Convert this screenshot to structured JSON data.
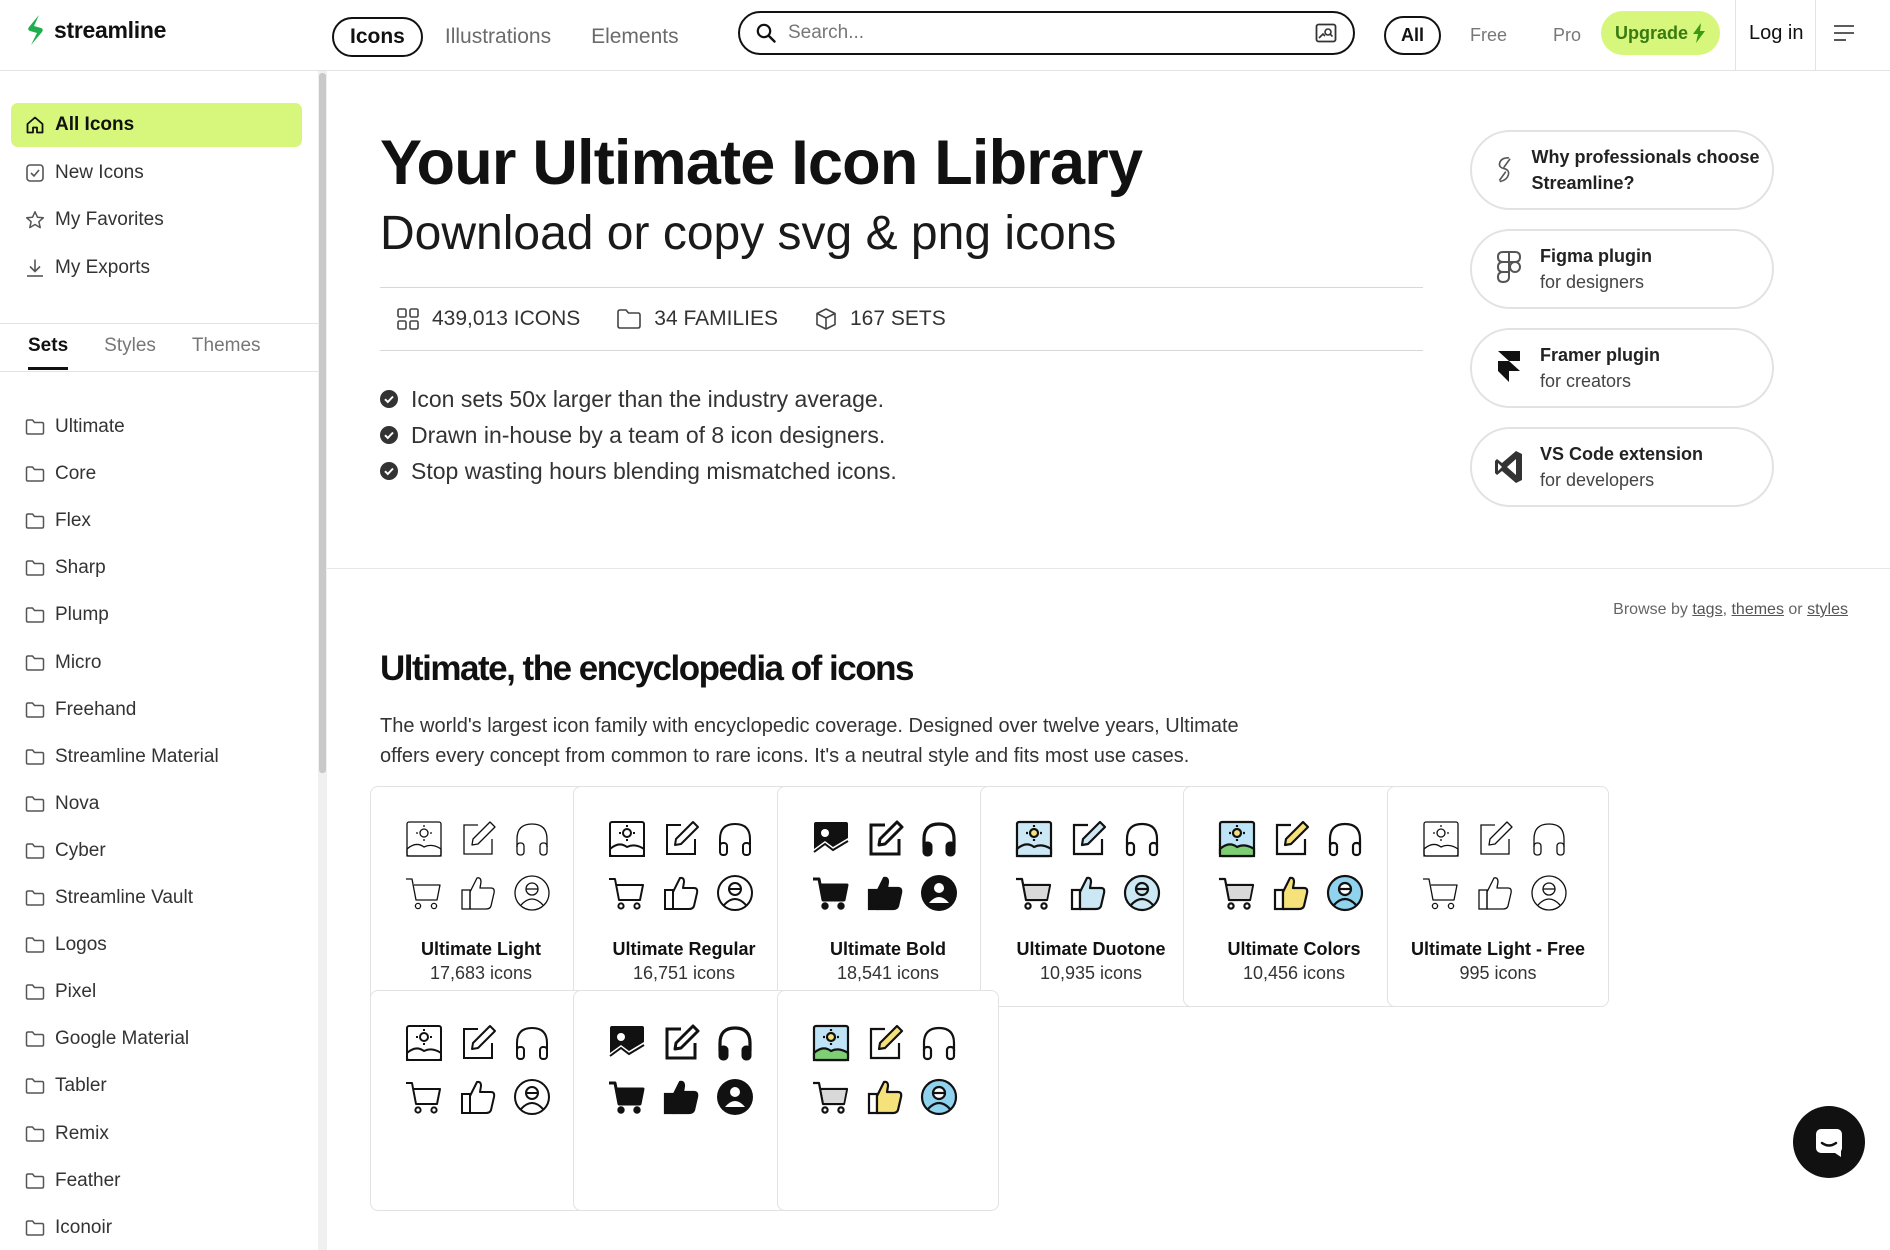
{
  "app": {
    "logo_text": "streamline",
    "brand_color": "#1fae4b",
    "accent": "#d6f77b"
  },
  "nav": {
    "tabs": [
      {
        "label": "Icons"
      },
      {
        "label": "Illustrations"
      },
      {
        "label": "Elements"
      }
    ]
  },
  "search": {
    "placeholder": "Search..."
  },
  "filters": [
    {
      "label": "All"
    },
    {
      "label": "Free"
    },
    {
      "label": "Pro"
    }
  ],
  "header": {
    "upgrade_label": "Upgrade",
    "login_label": "Log in"
  },
  "sidebar": {
    "top_items": [
      {
        "label": "All Icons",
        "icon": "home-icon"
      },
      {
        "label": "New Icons",
        "icon": "checkbox-icon"
      },
      {
        "label": "My Favorites",
        "icon": "star-icon"
      },
      {
        "label": "My Exports",
        "icon": "download-icon"
      }
    ],
    "tabs": [
      {
        "label": "Sets"
      },
      {
        "label": "Styles"
      },
      {
        "label": "Themes"
      }
    ],
    "sets": [
      "Ultimate",
      "Core",
      "Flex",
      "Sharp",
      "Plump",
      "Micro",
      "Freehand",
      "Streamline Material",
      "Nova",
      "Cyber",
      "Streamline Vault",
      "Logos",
      "Pixel",
      "Google Material",
      "Tabler",
      "Remix",
      "Feather",
      "Iconoir"
    ]
  },
  "hero": {
    "title": "Your Ultimate Icon Library",
    "subtitle": "Download or copy svg & png icons",
    "stats": [
      {
        "label": "439,013 ICONS",
        "icon": "grid-icon"
      },
      {
        "label": "34 FAMILIES",
        "icon": "folder-icon"
      },
      {
        "label": "167 SETS",
        "icon": "cube-icon"
      }
    ],
    "bullets": [
      "Icon sets 50x larger than the industry average.",
      "Drawn in-house by a team of 8 icon designers.",
      "Stop wasting hours blending mismatched icons."
    ]
  },
  "promos": [
    {
      "title": "Why professionals choose Streamline?",
      "subtitle": "",
      "icon": "streamline-logo-icon"
    },
    {
      "title": "Figma plugin",
      "subtitle": "for designers",
      "icon": "figma-icon"
    },
    {
      "title": "Framer plugin",
      "subtitle": "for creators",
      "icon": "framer-icon"
    },
    {
      "title": "VS Code extension",
      "subtitle": "for developers",
      "icon": "vscode-icon"
    }
  ],
  "browse": {
    "prefix": "Browse by",
    "tags": "tags",
    "comma": ",",
    "themes": "themes",
    "or": "or",
    "styles": "styles"
  },
  "section": {
    "title": "Ultimate, the encyclopedia of icons",
    "description": "The world's largest icon family with encyclopedic coverage. Designed over twelve years, Ultimate offers every concept from common to rare icons. It's a neutral style and fits most use cases."
  },
  "cards": [
    {
      "name": "Ultimate Light",
      "count": "17,683 icons",
      "style": "light"
    },
    {
      "name": "Ultimate Regular",
      "count": "16,751 icons",
      "style": "regular"
    },
    {
      "name": "Ultimate Bold",
      "count": "18,541 icons",
      "style": "bold"
    },
    {
      "name": "Ultimate Duotone",
      "count": "10,935 icons",
      "style": "duotone"
    },
    {
      "name": "Ultimate Colors",
      "count": "10,456 icons",
      "style": "colors"
    },
    {
      "name": "Ultimate Light - Free",
      "count": "995 icons",
      "style": "light"
    },
    {
      "name": "",
      "count": "",
      "style": "regular"
    },
    {
      "name": "",
      "count": "",
      "style": "bold"
    },
    {
      "name": "",
      "count": "",
      "style": "colors"
    }
  ]
}
